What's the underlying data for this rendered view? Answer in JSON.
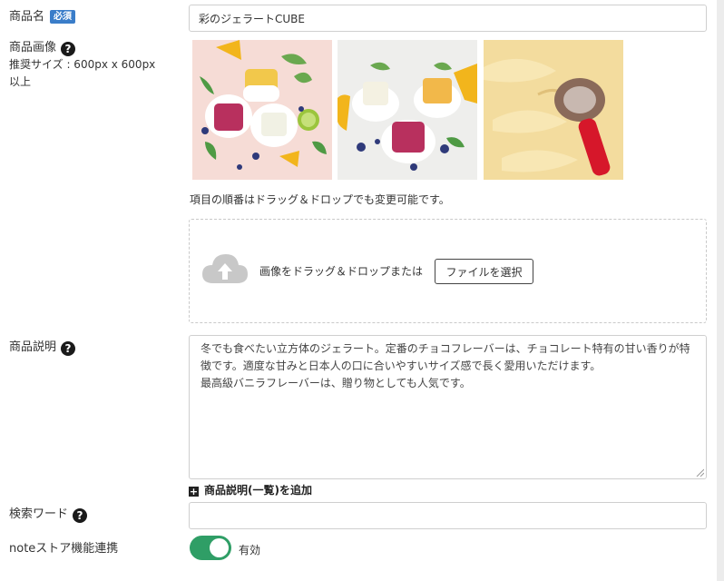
{
  "product_name": {
    "label": "商品名",
    "required_badge": "必須",
    "value": "彩のジェラートCUBE"
  },
  "product_image": {
    "label": "商品画像",
    "note": "推奨サイズ : 600px x 600px以上",
    "images": [
      {
        "icon": "gelato-cubes-flatlay-image"
      },
      {
        "icon": "gelato-cubes-bowls-image"
      },
      {
        "icon": "vanilla-gelato-scoop-image"
      }
    ],
    "reorder_hint": "項目の順番はドラッグ＆ドロップでも変更可能です。",
    "dropzone_text": "画像をドラッグ＆ドロップまたは",
    "file_button": "ファイルを選択"
  },
  "product_description": {
    "label": "商品説明",
    "value": "冬でも食べたい立方体のジェラート。定番のチョコフレーバーは、チョコレート特有の甘い香りが特徴です。適度な甘みと日本人の口に合いやすいサイズ感で長く愛用いただけます。\n最高級バニラフレーバーは、贈り物としても人気です。",
    "add_link": "商品説明(一覧)を追加"
  },
  "search_words": {
    "label": "検索ワード",
    "value": ""
  },
  "note_store": {
    "label": "noteストア機能連携",
    "toggle_label": "有効",
    "enabled": true
  },
  "colors": {
    "required_badge": "#3a7dc9",
    "toggle_on": "#2f9e66"
  }
}
